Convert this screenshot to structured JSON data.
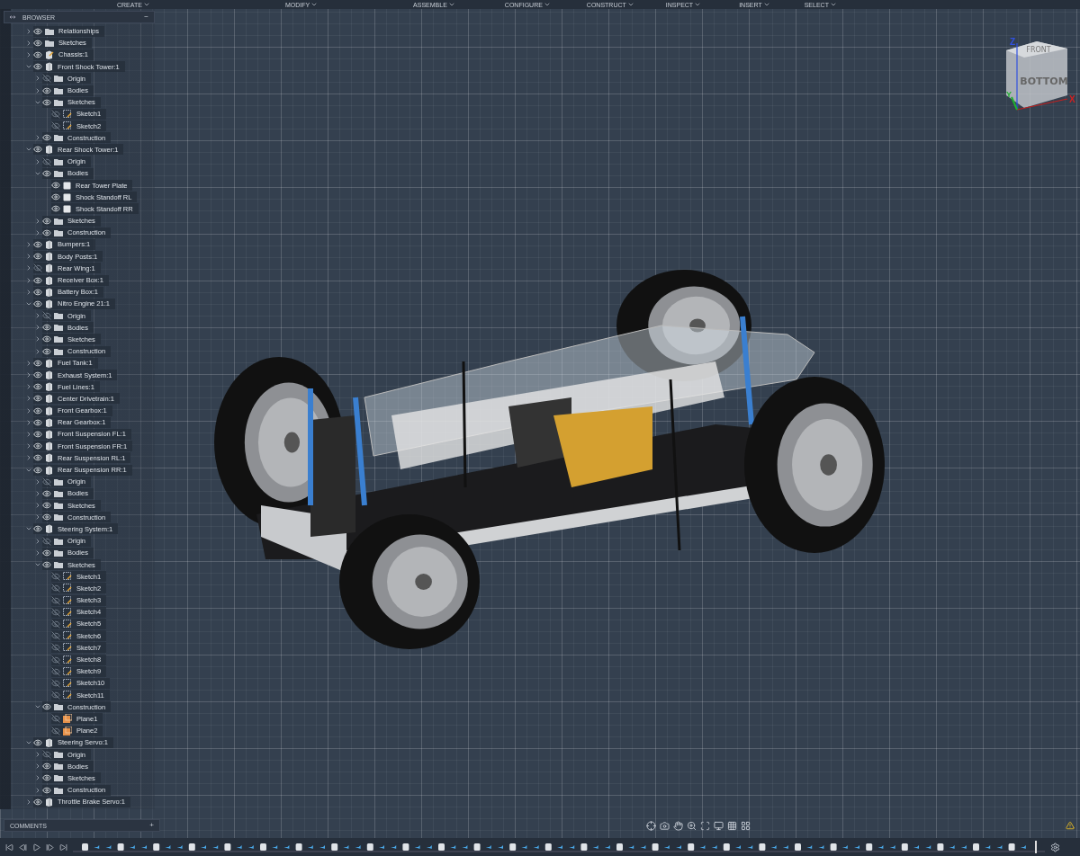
{
  "toolbar": {
    "menus": [
      "CREATE",
      "MODIFY",
      "ASSEMBLE",
      "CONFIGURE",
      "CONSTRUCT",
      "INSPECT",
      "INSERT",
      "SELECT"
    ]
  },
  "browser": {
    "title": "BROWSER",
    "collapse": "−",
    "items": [
      {
        "label": "Relationships",
        "kind": "folder",
        "visible": true,
        "expanded": false
      },
      {
        "label": "Sketches",
        "kind": "folder",
        "visible": true,
        "expanded": false
      },
      {
        "label": "Chassis:1",
        "kind": "chassis",
        "visible": true,
        "expanded": false
      },
      {
        "label": "Front Shock Tower:1",
        "kind": "component",
        "visible": true,
        "expanded": true,
        "children": [
          {
            "label": "Origin",
            "kind": "folder",
            "visible": false,
            "expanded": false
          },
          {
            "label": "Bodies",
            "kind": "folder",
            "visible": true,
            "expanded": false
          },
          {
            "label": "Sketches",
            "kind": "folder",
            "visible": true,
            "expanded": true,
            "children": [
              {
                "label": "Sketch1",
                "kind": "sketch",
                "visible": false
              },
              {
                "label": "Sketch2",
                "kind": "sketch",
                "visible": false
              }
            ]
          },
          {
            "label": "Construction",
            "kind": "folder",
            "visible": true,
            "expanded": false
          }
        ]
      },
      {
        "label": "Rear Shock Tower:1",
        "kind": "component",
        "visible": true,
        "expanded": true,
        "children": [
          {
            "label": "Origin",
            "kind": "folder",
            "visible": false,
            "expanded": false
          },
          {
            "label": "Bodies",
            "kind": "folder",
            "visible": true,
            "expanded": true,
            "children": [
              {
                "label": "Rear Tower Plate",
                "kind": "body",
                "visible": true
              },
              {
                "label": "Shock Standoff RL",
                "kind": "body",
                "visible": true
              },
              {
                "label": "Shock Standoff RR",
                "kind": "body",
                "visible": true
              }
            ]
          },
          {
            "label": "Sketches",
            "kind": "folder",
            "visible": true,
            "expanded": false
          },
          {
            "label": "Construction",
            "kind": "folder",
            "visible": true,
            "expanded": false
          }
        ]
      },
      {
        "label": "Bumpers:1",
        "kind": "component",
        "visible": true,
        "expanded": false
      },
      {
        "label": "Body Posts:1",
        "kind": "component",
        "visible": true,
        "expanded": false
      },
      {
        "label": "Rear Wing:1",
        "kind": "component",
        "visible": false,
        "expanded": false
      },
      {
        "label": "Receiver Box:1",
        "kind": "component",
        "visible": true,
        "expanded": false
      },
      {
        "label": "Battery Box:1",
        "kind": "component",
        "visible": true,
        "expanded": false
      },
      {
        "label": "Nitro Engine 21:1",
        "kind": "component",
        "visible": true,
        "expanded": true,
        "children": [
          {
            "label": "Origin",
            "kind": "folder",
            "visible": false,
            "expanded": false
          },
          {
            "label": "Bodies",
            "kind": "folder",
            "visible": true,
            "expanded": false
          },
          {
            "label": "Sketches",
            "kind": "folder",
            "visible": true,
            "expanded": false
          },
          {
            "label": "Construction",
            "kind": "folder",
            "visible": true,
            "expanded": false
          }
        ]
      },
      {
        "label": "Fuel Tank:1",
        "kind": "component",
        "visible": true,
        "expanded": false
      },
      {
        "label": "Exhaust System:1",
        "kind": "component",
        "visible": true,
        "expanded": false
      },
      {
        "label": "Fuel Lines:1",
        "kind": "component",
        "visible": true,
        "expanded": false
      },
      {
        "label": "Center Drivetrain:1",
        "kind": "component",
        "visible": true,
        "expanded": false
      },
      {
        "label": "Front Gearbox:1",
        "kind": "component",
        "visible": true,
        "expanded": false
      },
      {
        "label": "Rear Gearbox:1",
        "kind": "component",
        "visible": true,
        "expanded": false
      },
      {
        "label": "Front Suspension FL:1",
        "kind": "component",
        "visible": true,
        "expanded": false
      },
      {
        "label": "Front Suspension FR:1",
        "kind": "component",
        "visible": true,
        "expanded": false
      },
      {
        "label": "Rear Suspension RL:1",
        "kind": "component",
        "visible": true,
        "expanded": false
      },
      {
        "label": "Rear Suspension RR:1",
        "kind": "component",
        "visible": true,
        "expanded": true,
        "children": [
          {
            "label": "Origin",
            "kind": "folder",
            "visible": false,
            "expanded": false
          },
          {
            "label": "Bodies",
            "kind": "folder",
            "visible": true,
            "expanded": false
          },
          {
            "label": "Sketches",
            "kind": "folder",
            "visible": true,
            "expanded": false
          },
          {
            "label": "Construction",
            "kind": "folder",
            "visible": true,
            "expanded": false
          }
        ]
      },
      {
        "label": "Steering System:1",
        "kind": "component",
        "visible": true,
        "expanded": true,
        "children": [
          {
            "label": "Origin",
            "kind": "folder",
            "visible": false,
            "expanded": false
          },
          {
            "label": "Bodies",
            "kind": "folder",
            "visible": true,
            "expanded": false
          },
          {
            "label": "Sketches",
            "kind": "folder",
            "visible": true,
            "expanded": true,
            "children": [
              {
                "label": "Sketch1",
                "kind": "sketch",
                "visible": false
              },
              {
                "label": "Sketch2",
                "kind": "sketch",
                "visible": false
              },
              {
                "label": "Sketch3",
                "kind": "sketch",
                "visible": false
              },
              {
                "label": "Sketch4",
                "kind": "sketch",
                "visible": false
              },
              {
                "label": "Sketch5",
                "kind": "sketch",
                "visible": false
              },
              {
                "label": "Sketch6",
                "kind": "sketch",
                "visible": false
              },
              {
                "label": "Sketch7",
                "kind": "sketch",
                "visible": false
              },
              {
                "label": "Sketch8",
                "kind": "sketch",
                "visible": false
              },
              {
                "label": "Sketch9",
                "kind": "sketch",
                "visible": false
              },
              {
                "label": "Sketch10",
                "kind": "sketch",
                "visible": false
              },
              {
                "label": "Sketch11",
                "kind": "sketch",
                "visible": false
              }
            ]
          },
          {
            "label": "Construction",
            "kind": "folder",
            "visible": true,
            "expanded": true,
            "children": [
              {
                "label": "Plane1",
                "kind": "plane",
                "visible": false
              },
              {
                "label": "Plane2",
                "kind": "plane",
                "visible": false
              }
            ]
          }
        ]
      },
      {
        "label": "Steering Servo:1",
        "kind": "component",
        "visible": true,
        "expanded": true,
        "children": [
          {
            "label": "Origin",
            "kind": "folder",
            "visible": false,
            "expanded": false
          },
          {
            "label": "Bodies",
            "kind": "folder",
            "visible": true,
            "expanded": false
          },
          {
            "label": "Sketches",
            "kind": "folder",
            "visible": true,
            "expanded": false
          },
          {
            "label": "Construction",
            "kind": "folder",
            "visible": true,
            "expanded": false
          }
        ]
      },
      {
        "label": "Throttle Brake Servo:1",
        "kind": "component",
        "visible": true,
        "expanded": false
      }
    ]
  },
  "view_cube": {
    "top_face": "FRONT",
    "side_face": "BOTTOM",
    "axes": [
      "Z",
      "Y",
      "X"
    ]
  },
  "comments": {
    "title": "COMMENTS",
    "add": "+"
  }
}
